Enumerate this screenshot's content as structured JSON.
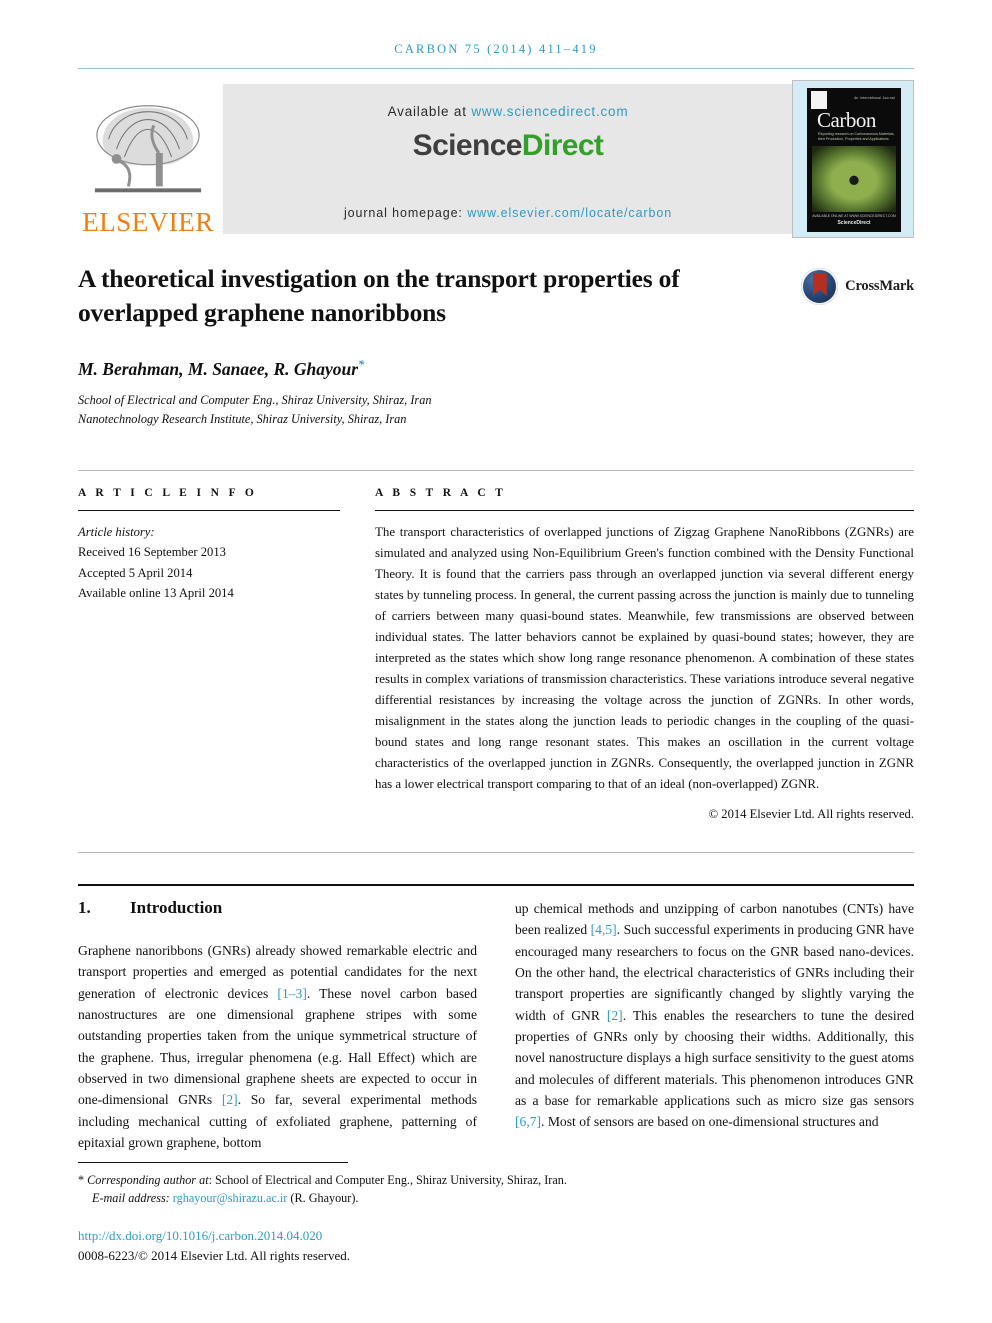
{
  "running_head": "CARBON 75 (2014) 411–419",
  "masthead": {
    "publisher_name": "ELSEVIER",
    "available_prefix": "Available at",
    "available_url": "www.sciencedirect.com",
    "logo_part1": "Science",
    "logo_part2": "Direct",
    "homepage_prefix": "journal homepage:",
    "homepage_url": "www.elsevier.com/locate/carbon",
    "cover": {
      "journal": "Carbon",
      "kicker": "An International Journal",
      "subtitle": "Reporting research on Carbonaceous Materials, their Production, Properties and Applications",
      "footer_small": "AVAILABLE ONLINE AT WWW.SCIENCEDIRECT.COM",
      "footer_brand": "ScienceDirect"
    }
  },
  "crossmark": {
    "label": "CrossMark"
  },
  "article": {
    "title": "A theoretical investigation on the transport properties of overlapped graphene nanoribbons",
    "authors": "M. Berahman, M. Sanaee, R. Ghayour",
    "corresponding_marker": "*",
    "affiliations": [
      "School of Electrical and Computer Eng., Shiraz University, Shiraz, Iran",
      "Nanotechnology Research Institute, Shiraz University, Shiraz, Iran"
    ]
  },
  "article_info": {
    "heading": "A R T I C L E   I N F O",
    "history_label": "Article history:",
    "received": "Received 16 September 2013",
    "accepted": "Accepted 5 April 2014",
    "online": "Available online 13 April 2014"
  },
  "abstract": {
    "heading": "A B S T R A C T",
    "text": "The transport characteristics of overlapped junctions of Zigzag Graphene NanoRibbons (ZGNRs) are simulated and analyzed using Non-Equilibrium Green's function combined with the Density Functional Theory. It is found that the carriers pass through an overlapped junction via several different energy states by tunneling process. In general, the current passing across the junction is mainly due to tunneling of carriers between many quasi-bound states. Meanwhile, few transmissions are observed between individual states. The latter behaviors cannot be explained by quasi-bound states; however, they are interpreted as the states which show long range resonance phenomenon. A combination of these states results in complex variations of transmission characteristics. These variations introduce several negative differential resistances by increasing the voltage across the junction of ZGNRs. In other words, misalignment in the states along the junction leads to periodic changes in the coupling of the quasi-bound states and long range resonant states. This makes an oscillation in the current voltage characteristics of the overlapped junction in ZGNRs. Consequently, the overlapped junction in ZGNR has a lower electrical transport comparing to that of an ideal (non-overlapped) ZGNR.",
    "copyright": "© 2014 Elsevier Ltd. All rights reserved."
  },
  "introduction": {
    "number": "1.",
    "heading": "Introduction",
    "left_col": {
      "part1": "Graphene nanoribbons (GNRs) already showed remarkable electric and transport properties and emerged as potential candidates for the next generation of electronic devices ",
      "ref1": "[1–3]",
      "part2": ". These novel carbon based nanostructures are one dimensional graphene stripes with some outstanding properties taken from the unique symmetrical structure of the graphene. Thus, irregular phenomena (e.g. Hall Effect) which are observed in two dimensional graphene sheets are expected to occur in one-dimensional GNRs ",
      "ref2": "[2]",
      "part3": ". So far, several experimental methods including mechanical cutting of exfoliated graphene, patterning of epitaxial grown graphene, bottom"
    },
    "right_col": {
      "part1": "up chemical methods and unzipping of carbon nanotubes (CNTs) have been realized ",
      "ref1": "[4,5]",
      "part2": ". Such successful experiments in producing GNR have encouraged many researchers to focus on the GNR based nano-devices. On the other hand, the electrical characteristics of GNRs including their transport properties are significantly changed by slightly varying the width of GNR ",
      "ref2": "[2]",
      "part3": ". This enables the researchers to tune the desired properties of GNRs only by choosing their widths. Additionally, this novel nanostructure displays a high surface sensitivity to the guest atoms and molecules of different materials. This phenomenon introduces GNR as a base for remarkable applications such as micro size gas sensors ",
      "ref3": "[6,7]",
      "part4": ". Most of sensors are based on one-dimensional structures and"
    }
  },
  "footer": {
    "corresponding_marker": "*",
    "corresponding_text": "Corresponding author at",
    "corresponding_address": ": School of Electrical and Computer Eng., Shiraz University, Shiraz, Iran.",
    "email_label": "E-mail address:",
    "email": "rghayour@shirazu.ac.ir",
    "email_suffix": "(R. Ghayour).",
    "doi": "http://dx.doi.org/10.1016/j.carbon.2014.04.020",
    "issn_line": "0008-6223/© 2014 Elsevier Ltd. All rights reserved."
  },
  "colors": {
    "link_blue": "#2e9bc5",
    "elsevier_orange": "#f07f13",
    "sciencedirect_green": "#33a02c",
    "crossmark_red": "#b3301f",
    "crossmark_navy": "#24416e"
  }
}
